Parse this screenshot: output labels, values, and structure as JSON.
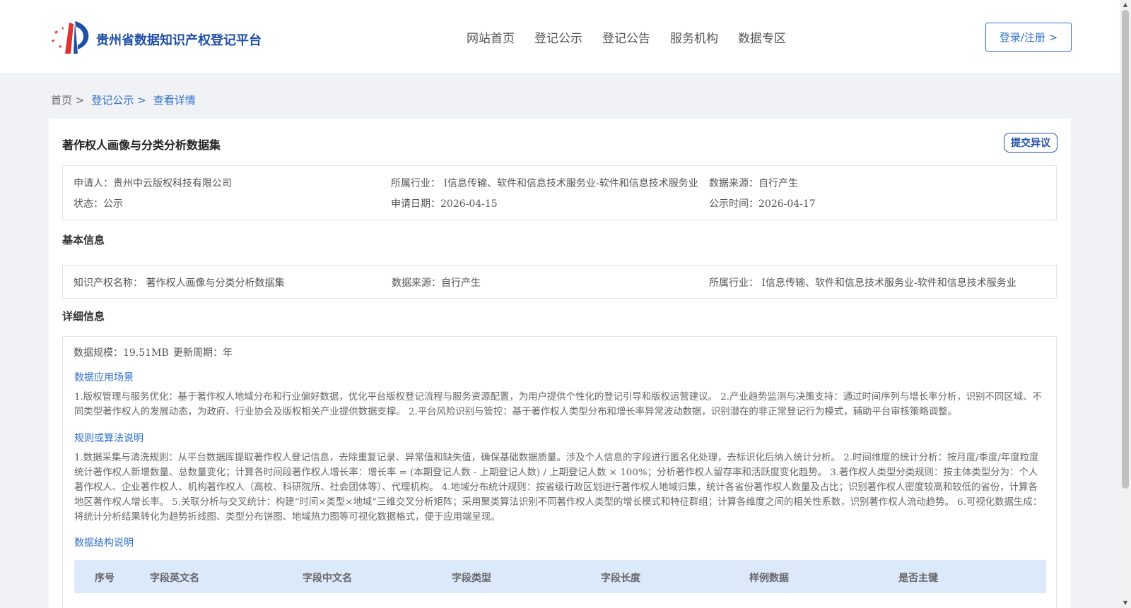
{
  "header": {
    "logo_text": "贵州省数据知识产权登记平台",
    "nav": [
      "网站首页",
      "登记公示",
      "登记公告",
      "服务机构",
      "数据专区"
    ],
    "login_label": "登录/注册 >"
  },
  "breadcrumb": {
    "home": "首页 >",
    "registration": "登记公示 >",
    "current": "查看详情"
  },
  "detail": {
    "title": "著作权人画像与分类分析数据集",
    "objection_label": "提交异议",
    "summary": {
      "applicant": "申请人：贵州中云版权科技有限公司",
      "industry": "所属行业： I信息传输、软件和信息技术服务业-软件和信息技术服务业",
      "source": "数据来源：自行产生",
      "status": "状态：公示",
      "apply_date": "申请日期：2026-04-15",
      "publish_date": "公示时间：2026-04-17"
    },
    "basic": {
      "section_title": "基本信息",
      "ip_name": "知识产权名称： 著作权人画像与分类分析数据集",
      "source": "数据来源：自行产生",
      "industry": "所属行业： I信息传输、软件和信息技术服务业-软件和信息技术服务业"
    },
    "info": {
      "section_title": "详细信息",
      "scale": "数据规模：19.51MB",
      "cycle": "更新周期：年",
      "scenario_title": "数据应用场景",
      "scenario_text": "1.版权管理与服务优化：基于著作权人地域分布和行业偏好数据，优化平台版权登记流程与服务资源配置，为用户提供个性化的登记引导和版权运营建议。 2.产业趋势监测与决策支持：通过时间序列与增长率分析，识别不同区域、不同类型著作权人的发展动态，为政府、行业协会及版权相关产业提供数据支撑。 2.平台风险识别与管控：基于著作权人类型分布和增长率异常波动数据，识别潜在的非正常登记行为模式，辅助平台审核策略调整。",
      "rules_title": "规则或算法说明",
      "rules_text": "1.数据采集与清洗规则：从平台数据库提取著作权人登记信息，去除重复记录、异常值和缺失值，确保基础数据质量。涉及个人信息的字段进行匿名化处理，去标识化后纳入统计分析。 2.时间维度的统计分析：按月度/季度/年度粒度统计著作权人新增数量、总数量变化；计算各时间段著作权人增长率：增长率 = (本期登记人数 - 上期登记人数) / 上期登记人数 × 100%；分析著作权人留存率和活跃度变化趋势。 3.著作权人类型分类规则：按主体类型分为：个人著作权人、企业著作权人、机构著作权人（高校、科研院所、社会团体等）、代理机构。 4.地域分布统计规则：按省级行政区划进行著作权人地域归集，统计各省份著作权人数量及占比；识别著作权人密度较高和较低的省份，计算各地区著作权人增长率。 5.关联分析与交叉统计：构建“时间×类型×地域”三维交叉分析矩阵；采用聚类算法识别不同著作权人类型的增长模式和特征群组；计算各维度之间的相关性系数，识别著作权人流动趋势。 6.可视化数据生成：将统计分析结果转化为趋势折线图、类型分布饼图、地域热力图等可视化数据格式，便于应用端呈现。",
      "structure_title": "数据结构说明",
      "table_headers": [
        "序号",
        "字段英文名",
        "字段中文名",
        "字段类型",
        "字段长度",
        "样例数据",
        "是否主键"
      ]
    }
  }
}
